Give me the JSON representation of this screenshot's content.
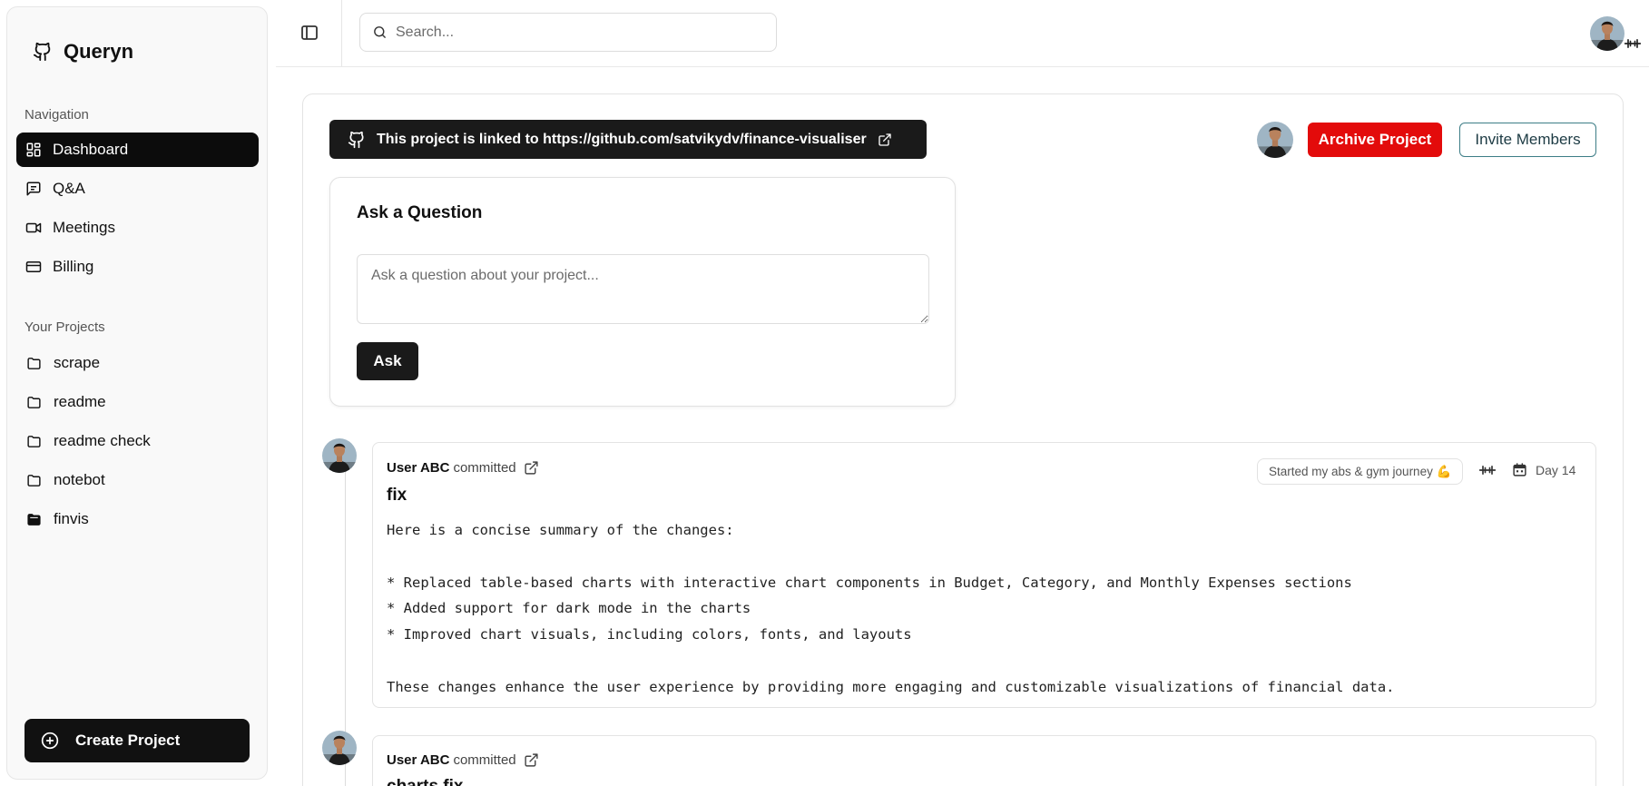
{
  "app": {
    "name": "Queryn"
  },
  "sidebar": {
    "navigation_label": "Navigation",
    "nav_items": [
      {
        "label": "Dashboard",
        "icon": "dashboard-icon",
        "active": true
      },
      {
        "label": "Q&A",
        "icon": "chat-icon"
      },
      {
        "label": "Meetings",
        "icon": "video-icon"
      },
      {
        "label": "Billing",
        "icon": "credit-card-icon"
      }
    ],
    "projects_label": "Your Projects",
    "projects": [
      {
        "label": "scrape"
      },
      {
        "label": "readme"
      },
      {
        "label": "readme check"
      },
      {
        "label": "notebot"
      },
      {
        "label": "finvis",
        "selected": true
      }
    ],
    "create_button": "Create Project"
  },
  "topbar": {
    "search_placeholder": "Search..."
  },
  "project": {
    "linked_text": "This project is linked to",
    "repo_url": "https://github.com/satvikydv/finance-visualiser",
    "archive_label": "Archive Project",
    "invite_label": "Invite Members"
  },
  "ask": {
    "title": "Ask a Question",
    "placeholder": "Ask a question about your project...",
    "button": "Ask"
  },
  "commits": [
    {
      "author": "User ABC",
      "action": "committed",
      "title": "fix",
      "summary": "Here is a concise summary of the changes:\n\n* Replaced table-based charts with interactive chart components in Budget, Category, and Monthly Expenses sections\n* Added support for dark mode in the charts\n* Improved chart visuals, including colors, fonts, and layouts\n\nThese changes enhance the user experience by providing more engaging and customizable visualizations of financial data."
    },
    {
      "author": "User ABC",
      "action": "committed",
      "title": "charts fix"
    }
  ],
  "status": {
    "text": "Started my abs & gym journey 💪",
    "day": "Day 14"
  },
  "colors": {
    "archive": "#e30b0b",
    "invite_border": "#3d7d86",
    "dark": "#111111"
  }
}
